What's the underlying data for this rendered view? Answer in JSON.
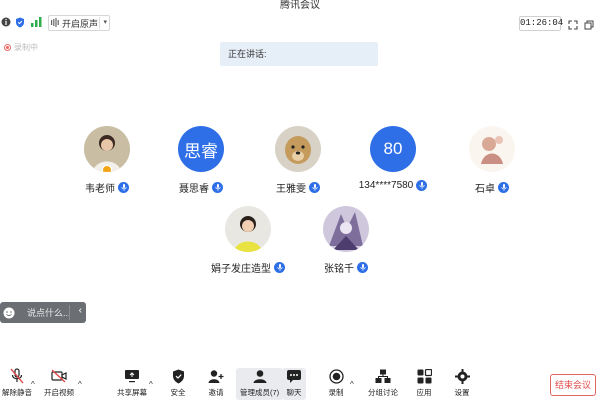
{
  "window": {
    "title": "腾讯会议"
  },
  "topbar": {
    "sound_button_label": "开启原声",
    "timer": "01:26:04"
  },
  "subtitle_indicator": {
    "label": "录制中"
  },
  "speaking": {
    "label": "正在讲话:"
  },
  "participants": [
    {
      "name": "韦老师",
      "avatar_type": "photo",
      "host": true
    },
    {
      "name": "聂思睿",
      "avatar_type": "text",
      "avatar_text": "思睿"
    },
    {
      "name": "王雅雯",
      "avatar_type": "photo"
    },
    {
      "name": "134****7580",
      "avatar_type": "text",
      "avatar_text": "80"
    },
    {
      "name": "石卓",
      "avatar_type": "photo"
    },
    {
      "name": "娟子发庄造型",
      "avatar_type": "photo"
    },
    {
      "name": "张铭千",
      "avatar_type": "photo"
    }
  ],
  "chat": {
    "placeholder": "说点什么..."
  },
  "toolbar": {
    "unmute": "解除静音",
    "video": "开启视频",
    "share": "共享屏幕",
    "security": "安全",
    "invite": "邀请",
    "members": "管理成员(7)",
    "chat": "聊天",
    "record": "录制",
    "breakout": "分组讨论",
    "apps": "应用",
    "settings": "设置",
    "end": "结束会议"
  },
  "colors": {
    "accent": "#2e6fe8",
    "end_red": "#e24b4b"
  }
}
